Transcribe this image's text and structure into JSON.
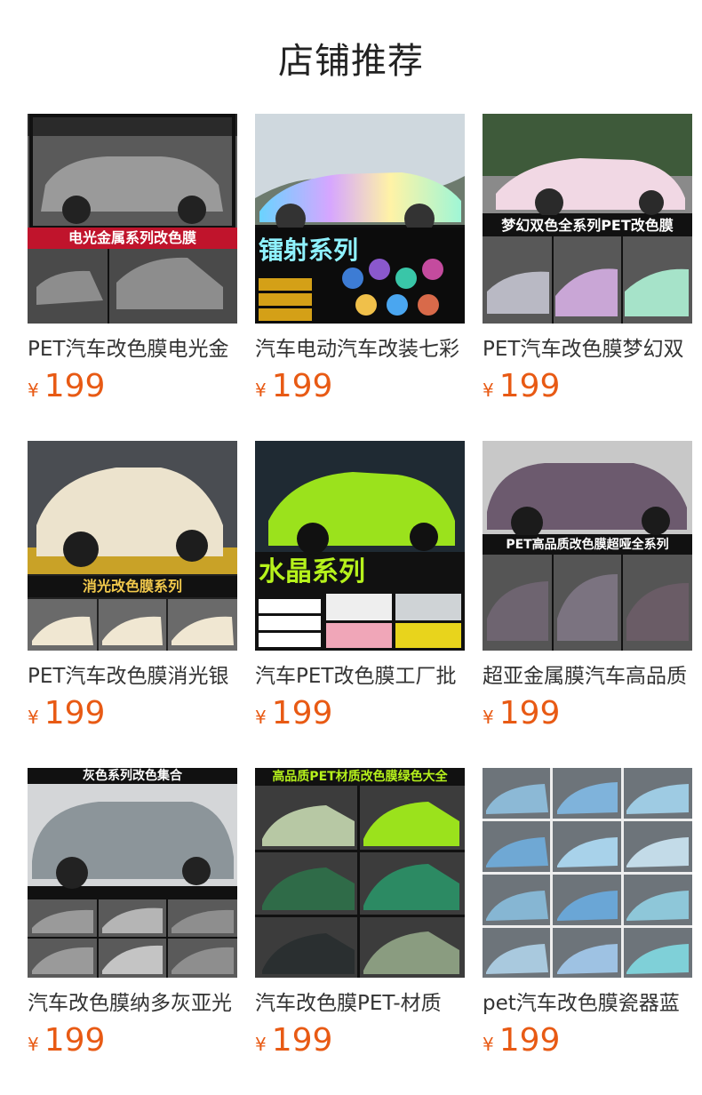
{
  "page": {
    "title": "店铺推荐"
  },
  "products": [
    {
      "name": "PET汽车改色膜电光金",
      "currency": "¥",
      "price": "199",
      "banner": "电光金属系列改色膜",
      "image": "bmw-gray-car-photo",
      "accent": "#c8c8c8"
    },
    {
      "name": "汽车电动汽车改装七彩",
      "currency": "¥",
      "price": "199",
      "banner": "镭射系列",
      "image": "holographic-car-photo",
      "accent": "#9fd7ff"
    },
    {
      "name": "PET汽车改色膜梦幻双",
      "currency": "¥",
      "price": "199",
      "banner": "梦幻双色全系列PET改色膜",
      "image": "pink-porsche-photo",
      "accent": "#f2d6e2"
    },
    {
      "name": "PET汽车改色膜消光银",
      "currency": "¥",
      "price": "199",
      "banner": "消光改色膜系列",
      "image": "matte-white-tesla-photo",
      "accent": "#efe6d2"
    },
    {
      "name": "汽车PET改色膜工厂批",
      "currency": "¥",
      "price": "199",
      "banner": "水晶系列",
      "image": "lime-green-tesla-photo",
      "accent": "#9be21c"
    },
    {
      "name": "超亚金属膜汽车高品质",
      "currency": "¥",
      "price": "199",
      "banner": "PET高品质改色膜超哑全系列",
      "image": "matte-purple-bmw-photo",
      "accent": "#6c5a6e"
    },
    {
      "name": "汽车改色膜纳多灰亚光",
      "currency": "¥",
      "price": "199",
      "banner": "灰色系列改色集合",
      "image": "gray-suv-collage-photo",
      "accent": "#8c959a"
    },
    {
      "name": "汽车改色膜PET-材质",
      "currency": "¥",
      "price": "199",
      "banner": "高品质PET材质改色膜绿色大全",
      "image": "green-cars-collage-photo",
      "accent": "#4c8f5c"
    },
    {
      "name": "pet汽车改色膜瓷器蓝",
      "currency": "¥",
      "price": "199",
      "banner": "",
      "image": "blue-cars-collage-photo",
      "accent": "#8cb9d6"
    }
  ]
}
